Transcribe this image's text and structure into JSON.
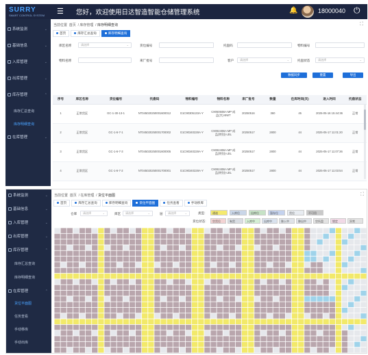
{
  "header": {
    "logo_text": "SURRY",
    "logo_sub": "SMART CONTROL SYSTEM",
    "menu_icon": "☰",
    "welcome": "您好，欢迎使用日达智造智能仓储管理系统",
    "bell_icon": "🔔",
    "username": "18000040",
    "power_icon": "⏻"
  },
  "screen1": {
    "sidebar": [
      {
        "label": "系统监测",
        "arrow": "⌄"
      },
      {
        "label": "基础信息",
        "arrow": "⌄"
      },
      {
        "label": "入库管理",
        "arrow": "⌄"
      },
      {
        "label": "出库管理",
        "arrow": "⌄"
      },
      {
        "label": "库存管理",
        "arrow": "⌃"
      }
    ],
    "sidebar_sub": [
      {
        "label": "库存汇总查询",
        "active": false
      },
      {
        "label": "库存明细查询",
        "active": true
      }
    ],
    "sidebar_last": {
      "label": "在库管理",
      "arrow": "⌄"
    },
    "breadcrumb": {
      "prefix": "当前位置",
      "items": [
        "首页",
        "库存管理",
        "库存明细查询"
      ]
    },
    "fullscreen_icon": "⛶",
    "tabs": [
      {
        "label": "首页",
        "active": false
      },
      {
        "label": "库存汇总查询",
        "active": false
      },
      {
        "label": "库存明细查询",
        "active": true
      }
    ],
    "filters": {
      "row1": [
        {
          "label": "库区名称",
          "placeholder": "请选择",
          "dropdown": true
        },
        {
          "label": "货位编号",
          "placeholder": "",
          "dropdown": false
        },
        {
          "label": "托盘码",
          "placeholder": "",
          "dropdown": false
        },
        {
          "label": "物料编号",
          "placeholder": "",
          "dropdown": false
        }
      ],
      "row2": [
        {
          "label": "物料名称",
          "placeholder": "",
          "dropdown": false
        },
        {
          "label": "来厂批号",
          "placeholder": "",
          "dropdown": false
        },
        {
          "label": "客户",
          "placeholder": "请选择",
          "dropdown": true
        },
        {
          "label": "托盘状态",
          "placeholder": "请选择",
          "dropdown": true
        }
      ]
    },
    "buttons": {
      "sync": "数据同步",
      "reset": "重置",
      "export": "导出"
    },
    "table": {
      "headers": [
        "序号",
        "库区名称",
        "货位编号",
        "托盘码",
        "物料编号",
        "物料名称",
        "来厂批号",
        "数量",
        "在库时间(天)",
        "进入时间",
        "托盘状态"
      ],
      "rows": [
        [
          "1",
          "正常货区",
          "GC-1-30-13-1",
          "NT045020250001600012",
          "G1C90305133A-Y",
          "C905050BA MP 成品(大)-BWT",
          "20250516",
          "360",
          "45",
          "2025-05-16 15:44:36",
          "正常"
        ],
        [
          "2",
          "正常货区",
          "GC-1-6-7-1",
          "NT045020250001700002",
          "G1C90340228A-Y",
          "C909240BA MP 成品(特别)-LBL",
          "20250517",
          "2800",
          "44",
          "2025-05-17 11:01:20",
          "正常"
        ],
        [
          "3",
          "正常货区",
          "GC-1-6-7-3",
          "NT045020250001600005",
          "G1C90340228A-Y",
          "C909240BA MP 成品(特别)-LBL",
          "20250517",
          "2800",
          "44",
          "2025-05-17 11:07:36",
          "正常"
        ],
        [
          "4",
          "正常货区",
          "GC-1-6-7-2",
          "NT045020250001700001",
          "G1C90340228A-Y",
          "C909240BA MP 成品(特别)-LBL",
          "20250517",
          "2800",
          "44",
          "2025-05-17 11:03:54",
          "正常"
        ],
        [
          "5",
          "正常货区",
          "GC-1-20-11-1",
          "NT045020250001600003",
          "G1C90340228A-Y",
          "C909240BA MP 成品(特别)-LBL",
          "20250517",
          "2800",
          "44",
          "2025-05-17 11:44:06",
          "正常"
        ]
      ]
    }
  },
  "screen2": {
    "sidebar": [
      {
        "label": "系统监测",
        "arrow": "⌄"
      },
      {
        "label": "基础信息",
        "arrow": "⌄"
      },
      {
        "label": "入库管理",
        "arrow": "⌄"
      },
      {
        "label": "出库管理",
        "arrow": "⌄"
      },
      {
        "label": "库存管理",
        "arrow": "⌃"
      }
    ],
    "sidebar_sub1": [
      "库存汇总查询",
      "库存明细查询"
    ],
    "sidebar_group2": {
      "label": "在库管理",
      "arrow": "⌃"
    },
    "sidebar_sub2": [
      {
        "label": "货位平面图",
        "active": true
      },
      {
        "label": "任务查看",
        "active": false
      },
      {
        "label": "手动移库",
        "active": false
      },
      {
        "label": "手动出库",
        "active": false
      }
    ],
    "breadcrumb": {
      "prefix": "当前位置",
      "items": [
        "首页",
        "在库管理",
        "货位平面图"
      ]
    },
    "fullscreen_icon": "⛶",
    "tabs": [
      {
        "label": "首页",
        "active": false
      },
      {
        "label": "库存汇总查询",
        "active": false
      },
      {
        "label": "库存明细查询",
        "active": false
      },
      {
        "label": "货位平面图",
        "active": true
      },
      {
        "label": "任务查看",
        "active": false
      },
      {
        "label": "手动移库",
        "active": false
      }
    ],
    "filters": [
      {
        "label": "仓库",
        "placeholder": "请选择"
      },
      {
        "label": "库区",
        "placeholder": "请选择"
      },
      {
        "label": "层",
        "placeholder": "请选择"
      }
    ],
    "legend_type_label": "类型:",
    "legend_status_label": "货位状态:",
    "legend_type": [
      {
        "label": "通道",
        "color": "#f5ea6e"
      },
      {
        "label": "入库位",
        "color": "#c9d6e8"
      },
      {
        "label": "出库位",
        "color": "#c6e2c6"
      },
      {
        "label": "暂存位",
        "color": "#c4d2ee"
      },
      {
        "label": "货位",
        "color": "#e8ecf1"
      },
      {
        "label": "不可用",
        "color": "#c9c9c9"
      }
    ],
    "legend_status": [
      {
        "label": "空货位",
        "color": "#f3d3d3"
      },
      {
        "label": "有货",
        "color": "#d9dde3"
      },
      {
        "label": "入库中",
        "color": "#d4efd4"
      },
      {
        "label": "出库中",
        "color": "#d9e2ee"
      },
      {
        "label": "移入中",
        "color": "#dfe3e8"
      },
      {
        "label": "移出中",
        "color": "#dfe3e8"
      },
      {
        "label": "空托盘",
        "color": "#e3e3e3"
      },
      {
        "label": "锁定",
        "color": "#f1d9e6"
      },
      {
        "label": "异常",
        "color": "#e3e3e3"
      }
    ],
    "map_colors": {
      "aisle": "#f2e96a",
      "occupied": "#b9a6ad",
      "empty": "#e6e8ec",
      "inbound": "#9fd3ea",
      "background": "#fff"
    }
  }
}
